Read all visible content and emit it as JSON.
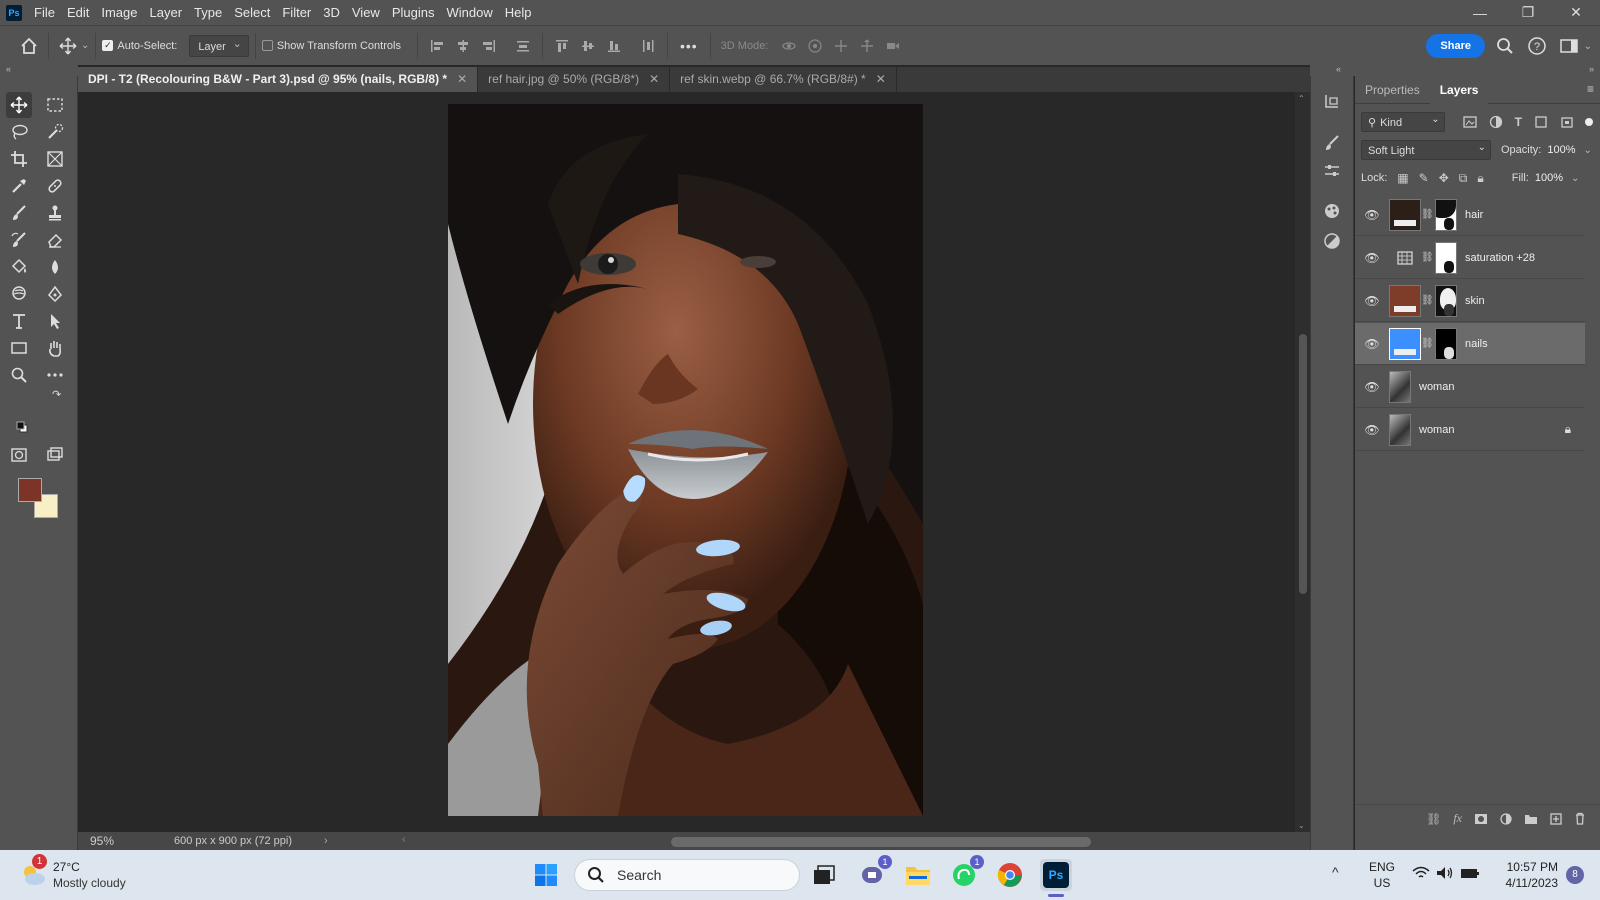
{
  "app": {
    "logo": "Ps"
  },
  "menu": [
    "File",
    "Edit",
    "Image",
    "Layer",
    "Type",
    "Select",
    "Filter",
    "3D",
    "View",
    "Plugins",
    "Window",
    "Help"
  ],
  "options": {
    "auto_select_label": "Auto-Select:",
    "auto_select_value": "Layer",
    "transform_label": "Show Transform Controls",
    "mode_3d_label": "3D Mode:",
    "share_label": "Share",
    "more": "•••"
  },
  "tabs": [
    {
      "label": "DPI - T2 (Recolouring B&W - Part 3).psd @ 95% (nails, RGB/8) *",
      "active": true
    },
    {
      "label": "ref hair.jpg @ 50% (RGB/8*)",
      "active": false
    },
    {
      "label": "ref skin.webp @ 66.7% (RGB/8#) *",
      "active": false
    }
  ],
  "status": {
    "zoom": "95%",
    "doc_size": "600 px x 900 px (72 ppi)"
  },
  "swatches": {
    "foreground": "#7b3427",
    "background": "#f9efc7"
  },
  "panel": {
    "tabs": [
      "Properties",
      "Layers"
    ],
    "filter": "Kind",
    "blend_mode": "Soft Light",
    "opacity_label": "Opacity:",
    "opacity_value": "100%",
    "lock_label": "Lock:",
    "fill_label": "Fill:",
    "fill_value": "100%",
    "layers": [
      {
        "name": "hair",
        "color": "#2b1f17",
        "type": "fill",
        "mask": "figure"
      },
      {
        "name": "saturation +28",
        "color": "#d0d0d0",
        "type": "adjustment",
        "mask": "white"
      },
      {
        "name": "skin",
        "color": "#7d3d28",
        "type": "fill",
        "mask": "figure"
      },
      {
        "name": "nails",
        "color": "#3b8fff",
        "type": "fill",
        "mask": "black",
        "selected": true
      },
      {
        "name": "woman",
        "type": "photo"
      },
      {
        "name": "woman",
        "type": "photo",
        "locked": true
      }
    ]
  },
  "taskbar": {
    "weather_temp": "27°C",
    "weather_desc": "Mostly cloudy",
    "weather_badge": "1",
    "search_label": "Search",
    "teams_badge": "1",
    "whatsapp_badge": "1",
    "lang": "ENG",
    "region": "US",
    "time": "10:57 PM",
    "date": "4/11/2023",
    "notif_count": "8"
  }
}
